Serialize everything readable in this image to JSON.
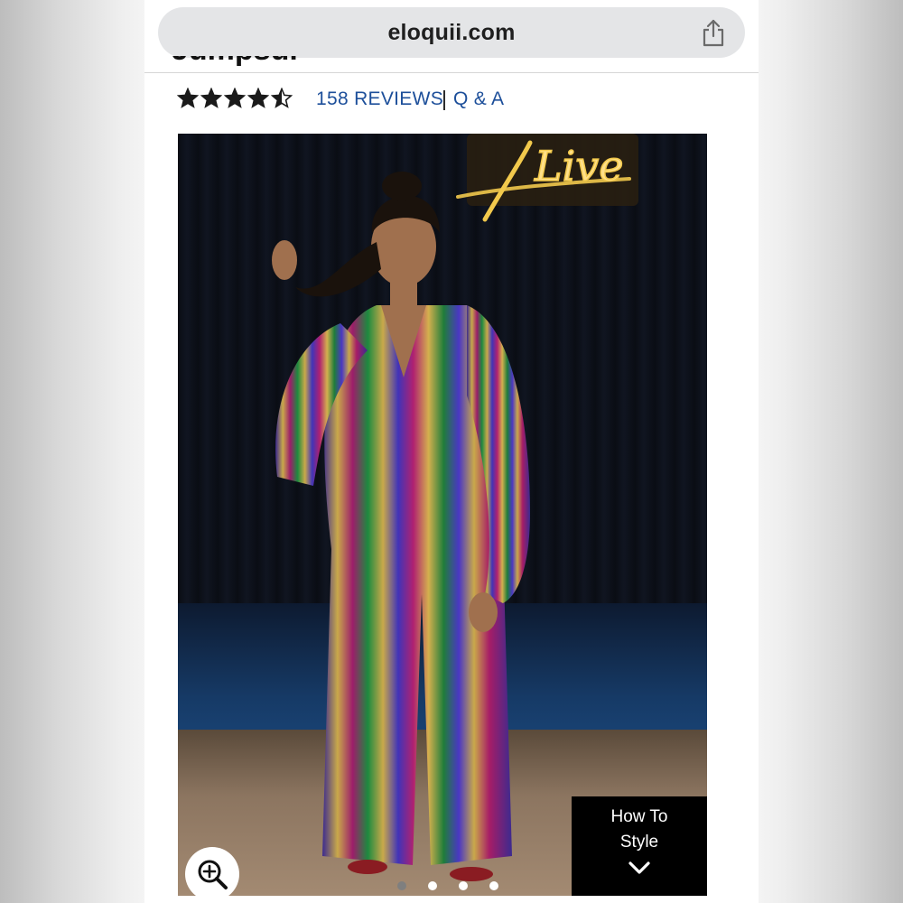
{
  "browser": {
    "url": "eloquii.com",
    "share_icon": "share-icon"
  },
  "product": {
    "title_partial": "Jumpsuit",
    "rating": 4.5,
    "rating_max": 5,
    "reviews_label": "158 REVIEWS",
    "separator": "|",
    "qa_label": "Q & A"
  },
  "gallery": {
    "neon_text": "Live",
    "zoom_icon": "zoom-in-icon",
    "how_to_line1": "How To",
    "how_to_line2": "Style",
    "how_to_icon": "chevron-down-icon",
    "page_count": 4,
    "active_index": 0
  },
  "colors": {
    "link": "#1d4f9a",
    "star": "#1a1a1a",
    "url_bar": "#e4e5e7",
    "neon": "#f2c94c"
  }
}
